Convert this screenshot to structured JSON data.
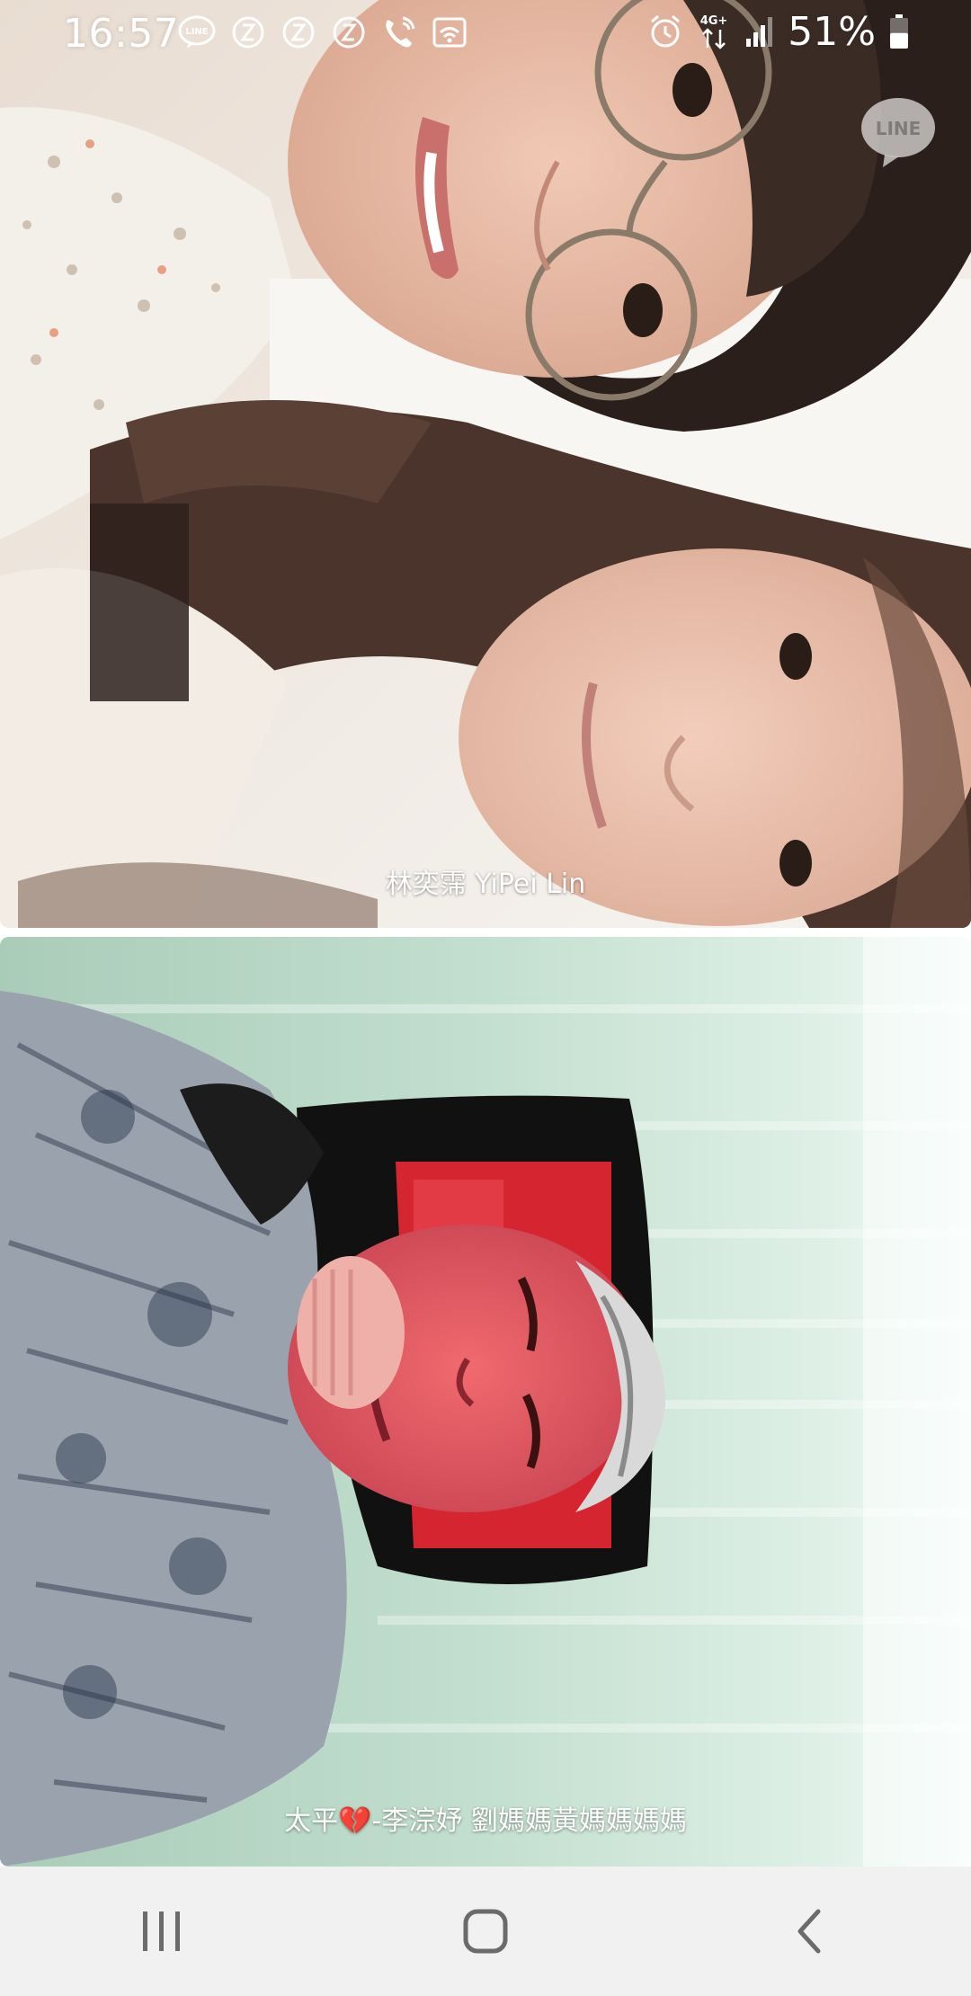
{
  "status_bar": {
    "time": "16:57",
    "battery_percent": "51%",
    "network_label": "4G+",
    "battery_level": 0.51,
    "icons": [
      "line-notification-icon",
      "sync-icon",
      "sync-icon",
      "sync-icon",
      "wifi-calling-icon",
      "wifi-icon",
      "alarm-icon",
      "4g-data-icon",
      "signal-icon",
      "battery-icon"
    ]
  },
  "call": {
    "watermark": "LINE",
    "participants": [
      {
        "name": "林奕霈 YiPei Lin"
      },
      {
        "name": "太平💔-李淙妤 劉媽媽黃媽媽媽媽"
      }
    ]
  },
  "nav_bar": {
    "buttons": [
      "recent-apps-icon",
      "home-icon",
      "back-icon"
    ]
  },
  "colors": {
    "nav_background": "#f1f1f1",
    "icon_gray": "#6b6b6b",
    "text_white": "#ffffff"
  }
}
